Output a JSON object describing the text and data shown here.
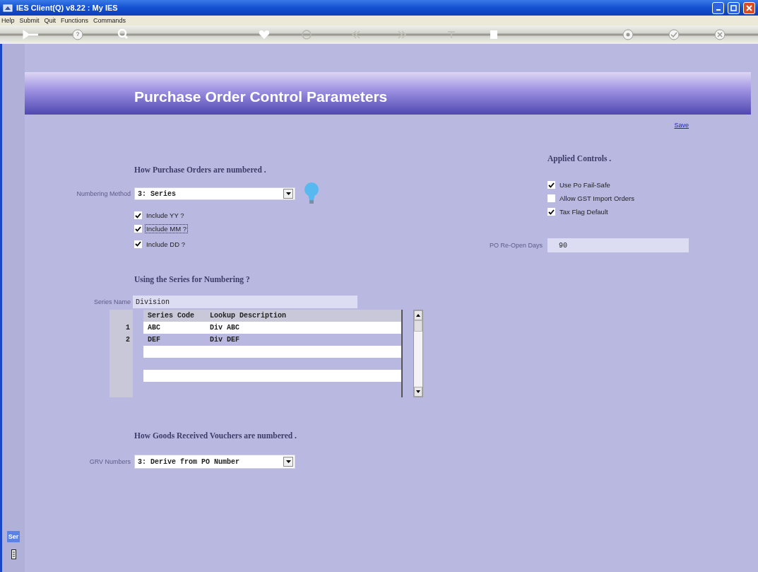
{
  "window": {
    "title": "IES Client(Q) v8.22 : My IES"
  },
  "menu": [
    "Help",
    "Submit",
    "Quit",
    "Functions",
    "Commands"
  ],
  "page": {
    "title": "Purchase Order Control Parameters",
    "save_link": "Save"
  },
  "numbering": {
    "heading": "How Purchase Orders are numbered .",
    "method": {
      "label": "Numbering Method",
      "value": "3: Series"
    },
    "options": [
      {
        "label": "Include YY ?",
        "checked": true,
        "focused": false
      },
      {
        "label": "Include MM ?",
        "checked": true,
        "focused": true
      },
      {
        "label": "Include DD ?",
        "checked": true,
        "focused": false
      }
    ]
  },
  "series": {
    "heading": "Using the Series for Numbering ?",
    "name": {
      "label": "Series Name",
      "value": "Division"
    },
    "table": {
      "columns": [
        "Series Code",
        "Lookup Description"
      ],
      "rows": [
        {
          "number": "1",
          "code": "ABC",
          "description": "Div ABC"
        },
        {
          "number": "2",
          "code": "DEF",
          "description": "Div DEF"
        }
      ]
    }
  },
  "grv": {
    "heading": "How Goods Received Vouchers are numbered .",
    "label": "GRV Numbers",
    "value": "3: Derive from PO Number"
  },
  "applied": {
    "heading": "Applied Controls .",
    "controls": [
      {
        "label": "Use Po Fail-Safe",
        "checked": true
      },
      {
        "label": "Allow GST Import Orders",
        "checked": false
      },
      {
        "label": "Tax Flag Default",
        "checked": true
      }
    ],
    "reopen": {
      "label": "PO Re-Open Days",
      "value": "90"
    }
  },
  "side_panel": {
    "tab": "Ser"
  }
}
